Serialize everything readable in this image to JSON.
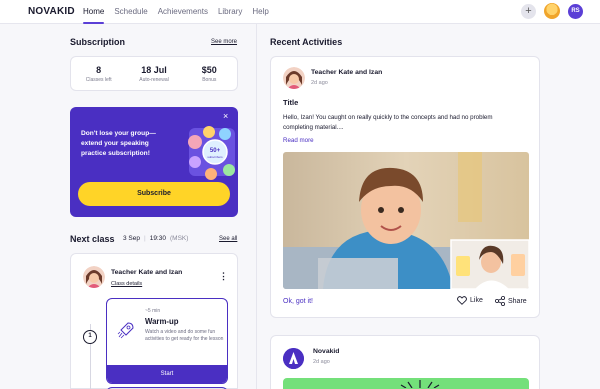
{
  "header": {
    "logo": "NOVAKID",
    "nav": [
      "Home",
      "Schedule",
      "Achievements",
      "Library",
      "Help"
    ],
    "plus": "+",
    "avatar_initials": "RS"
  },
  "subscription": {
    "title": "Subscription",
    "see_more": "See more",
    "stats": [
      {
        "value": "8",
        "label": "Classes left"
      },
      {
        "value": "18 Jul",
        "label": "Auto-renewal"
      },
      {
        "value": "$50",
        "label": "Bonus"
      }
    ]
  },
  "promo": {
    "text": "Don't lose your group—extend your speaking practice subscription!",
    "button": "Subscribe",
    "close": "×",
    "badge": "50+",
    "badge_sub": "subscribers"
  },
  "next_class": {
    "title": "Next class",
    "date": "3 Sep",
    "time": "19:30",
    "tz": "(MSK)",
    "see_all": "See all",
    "teacher": "Teacher Kate and Izan",
    "details": "Class details",
    "step": "1",
    "activity": {
      "duration": "~5 min",
      "title": "Warm-up",
      "desc": "Watch a video and do some fun activities to get ready for the lesson",
      "button": "Start"
    }
  },
  "recent": {
    "title": "Recent Activities",
    "post": {
      "author": "Teacher Kate and Izan",
      "time": "2d ago",
      "title": "Title",
      "body": "Hello, Izan! You caught on really quickly to the concepts and had no problem completing material....",
      "read_more": "Read more",
      "ok": "Ok, got it!",
      "like": "Like",
      "share": "Share"
    },
    "post2": {
      "author": "Novakid",
      "time": "2d ago"
    }
  },
  "colors": {
    "brand": "#4a2fc2",
    "accent_yellow": "#ffd427",
    "green": "#74e07a"
  }
}
